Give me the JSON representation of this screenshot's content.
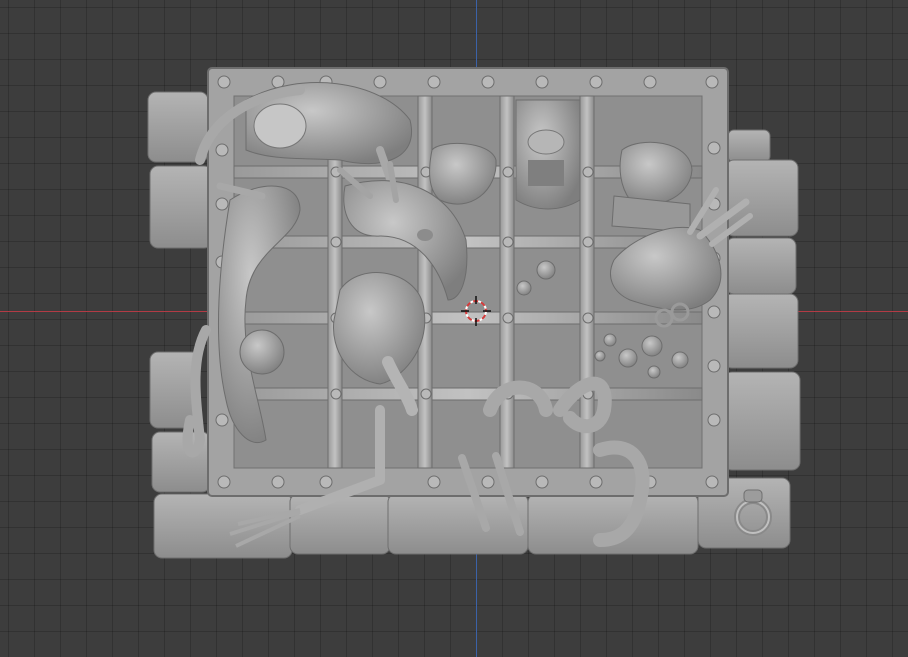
{
  "viewport": {
    "title": "",
    "background_color": "#3d3d3d",
    "grid_color": "#303030",
    "x_axis_color": "#b33b45",
    "y_axis_color": "#3b62a8",
    "model_color": "#a9a9a9",
    "model_shadow_color": "#6e6e6e",
    "icons": [
      "3d-cursor-icon"
    ]
  }
}
